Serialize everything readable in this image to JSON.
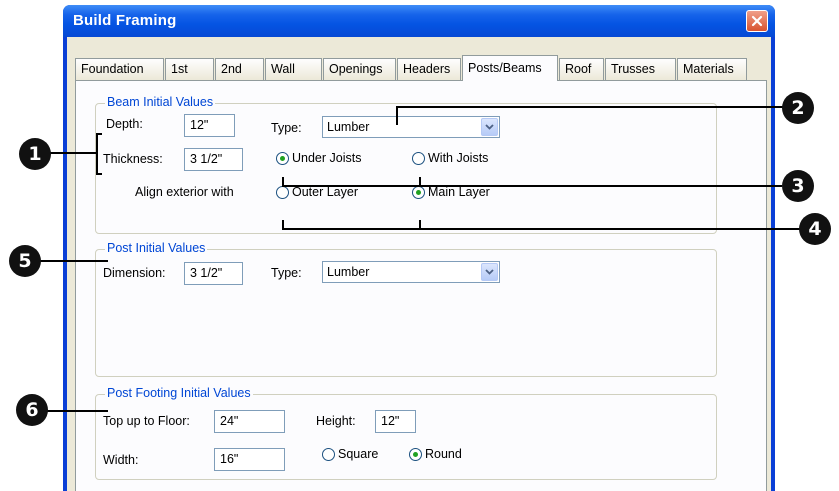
{
  "window": {
    "title": "Build Framing"
  },
  "tabs": [
    {
      "label": "Foundation",
      "active": false
    },
    {
      "label": "1st",
      "active": false
    },
    {
      "label": "2nd",
      "active": false
    },
    {
      "label": "Wall",
      "active": false
    },
    {
      "label": "Openings",
      "active": false
    },
    {
      "label": "Headers",
      "active": false
    },
    {
      "label": "Posts/Beams",
      "active": true
    },
    {
      "label": "Roof",
      "active": false
    },
    {
      "label": "Trusses",
      "active": false
    },
    {
      "label": "Materials",
      "active": false
    }
  ],
  "beam": {
    "group_label": "Beam Initial Values",
    "depth_label": "Depth:",
    "depth_value": "12\"",
    "thickness_label": "Thickness:",
    "thickness_value": "3 1/2\"",
    "type_label": "Type:",
    "type_value": "Lumber",
    "under_joists": "Under Joists",
    "with_joists": "With Joists",
    "joist_selected": "under",
    "align_label": "Align exterior with",
    "outer_layer": "Outer Layer",
    "main_layer": "Main Layer",
    "align_selected": "main"
  },
  "post": {
    "group_label": "Post Initial Values",
    "dimension_label": "Dimension:",
    "dimension_value": "3 1/2\"",
    "type_label": "Type:",
    "type_value": "Lumber"
  },
  "footing": {
    "group_label": "Post Footing Initial Values",
    "top_label": "Top up to Floor:",
    "top_value": "24\"",
    "height_label": "Height:",
    "height_value": "12\"",
    "width_label": "Width:",
    "width_value": "16\"",
    "square": "Square",
    "round": "Round",
    "shape_selected": "round"
  },
  "callouts": [
    "1",
    "2",
    "3",
    "4",
    "5",
    "6"
  ],
  "colors": {
    "titlebar": "#0554e3",
    "group_label": "#0046d5",
    "radio_dot": "#21a121",
    "close": "#d8532f"
  }
}
